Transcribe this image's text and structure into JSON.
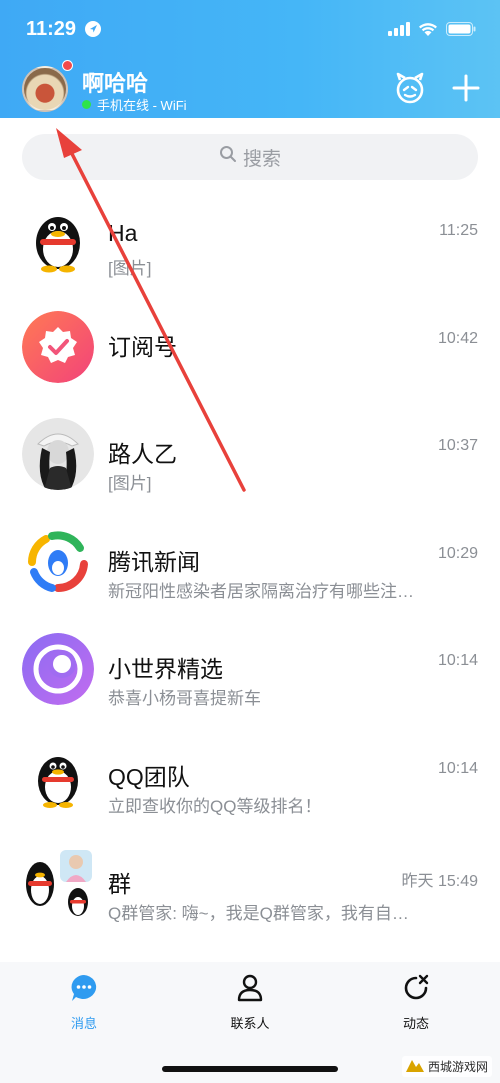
{
  "status_bar": {
    "time": "11:29"
  },
  "profile": {
    "name": "啊哈哈",
    "status": "手机在线 - WiFi"
  },
  "search": {
    "placeholder": "搜索"
  },
  "conversations": [
    {
      "name": "Ha",
      "preview": "[图片]",
      "time": "11:25",
      "avatar": "qq-penguin"
    },
    {
      "name": "订阅号",
      "preview": "",
      "time": "10:42",
      "avatar": "subscription-badge"
    },
    {
      "name": "路人乙",
      "preview": "[图片]",
      "time": "10:37",
      "avatar": "photo-person"
    },
    {
      "name": "腾讯新闻",
      "preview": "新冠阳性感染者居家隔离治疗有哪些注…",
      "time": "10:29",
      "avatar": "tencent-news"
    },
    {
      "name": "小世界精选",
      "preview": "恭喜小杨哥喜提新车",
      "time": "10:14",
      "avatar": "small-world"
    },
    {
      "name": "QQ团队",
      "preview": "立即查收你的QQ等级排名！",
      "time": "10:14",
      "avatar": "qq-penguin"
    },
    {
      "name": "群",
      "preview": "Q群管家: 嗨~，我是Q群管家，我有自…",
      "time": "昨天 15:49",
      "avatar": "group"
    }
  ],
  "tabs": [
    {
      "label": "消息",
      "icon": "message-icon",
      "active": true
    },
    {
      "label": "联系人",
      "icon": "contacts-icon",
      "active": false
    },
    {
      "label": "动态",
      "icon": "moments-icon",
      "active": false
    }
  ],
  "watermark": {
    "text": "西城游戏网"
  },
  "colors": {
    "header": "#45b6f7",
    "accent": "#2f9bf0",
    "annotation": "#e8413b"
  }
}
